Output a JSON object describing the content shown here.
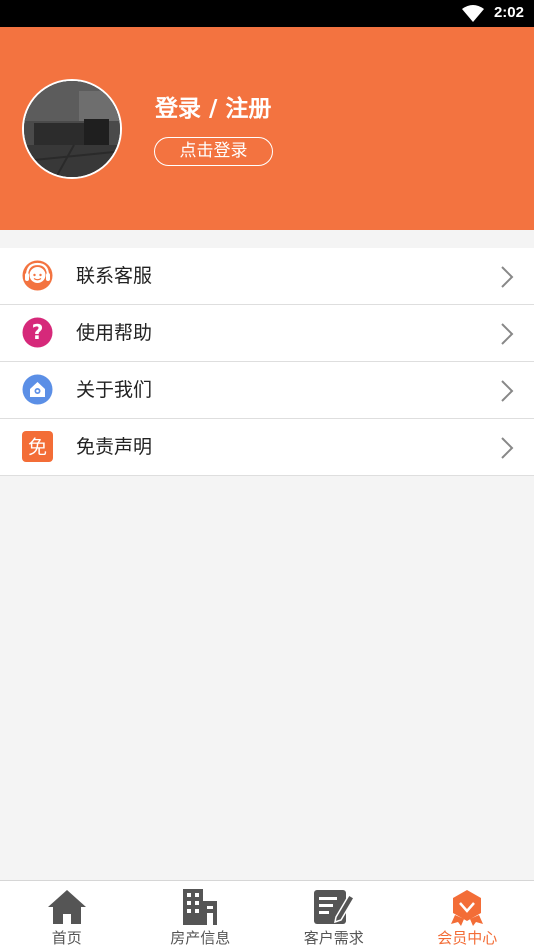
{
  "status_bar": {
    "time": "2:02"
  },
  "header": {
    "title": "登录 / 注册",
    "login_button": "点击登录"
  },
  "menu": {
    "items": [
      {
        "label": "联系客服",
        "icon": "customer-service-icon"
      },
      {
        "label": "使用帮助",
        "icon": "help-icon"
      },
      {
        "label": "关于我们",
        "icon": "about-us-icon"
      },
      {
        "label": "免责声明",
        "icon": "disclaimer-icon",
        "icon_text": "免"
      }
    ]
  },
  "tabbar": {
    "tabs": [
      {
        "label": "首页",
        "icon": "home-icon",
        "active": false
      },
      {
        "label": "房产信息",
        "icon": "building-icon",
        "active": false
      },
      {
        "label": "客户需求",
        "icon": "edit-document-icon",
        "active": false
      },
      {
        "label": "会员中心",
        "icon": "member-badge-icon",
        "active": true
      }
    ]
  },
  "colors": {
    "brand": "#f37340",
    "active_tab": "#f36d37",
    "help_icon": "#d6297a",
    "about_icon": "#5b8fe6",
    "disclaimer_icon": "#f36d37"
  }
}
